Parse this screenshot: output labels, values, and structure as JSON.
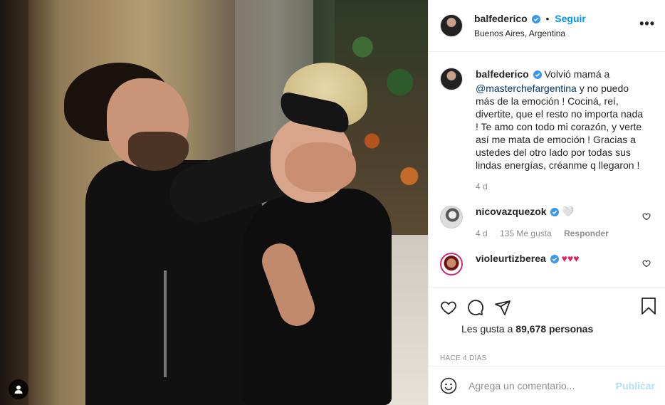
{
  "post": {
    "username": "balfederico",
    "separator": "•",
    "follow_label": "Seguir",
    "location": "Buenos Aires, Argentina",
    "more_label": "•••"
  },
  "caption": {
    "username": "balfederico",
    "text_before": "Volvió mamá a",
    "mention": "@masterchefargentina",
    "text_after": "y no puedo más de la emoción ! Cociná, reí, divertite, que el resto no importa nada ! Te amo con todo mi corazón, y verte así me mata de emoción ! Gracias a ustedes del otro lado por todas sus lindas energías, créanme q llegaron !",
    "age": "4 d"
  },
  "comments": [
    {
      "username": "nicovazquezok",
      "text": "🤍",
      "age": "4 d",
      "likes": "135 Me gusta",
      "reply_label": "Responder"
    },
    {
      "username": "violeurtizberea",
      "text": "♥♥♥"
    }
  ],
  "actions": {
    "likes_prefix": "Les gusta a",
    "likes_count": "89,678",
    "likes_suffix": "personas",
    "timestamp": "HACE 4 DÍAS"
  },
  "composer": {
    "placeholder": "Agrega un comentario...",
    "publish_label": "Publicar"
  },
  "colors": {
    "accent": "#0095f6",
    "verified": "#3897f0",
    "publish_disabled": "#b2dffc",
    "heart": "#e0245e"
  },
  "icons": [
    "user-tag-icon",
    "verified-icon",
    "more-icon",
    "heart-icon",
    "comment-icon",
    "share-icon",
    "bookmark-icon",
    "smile-icon"
  ]
}
